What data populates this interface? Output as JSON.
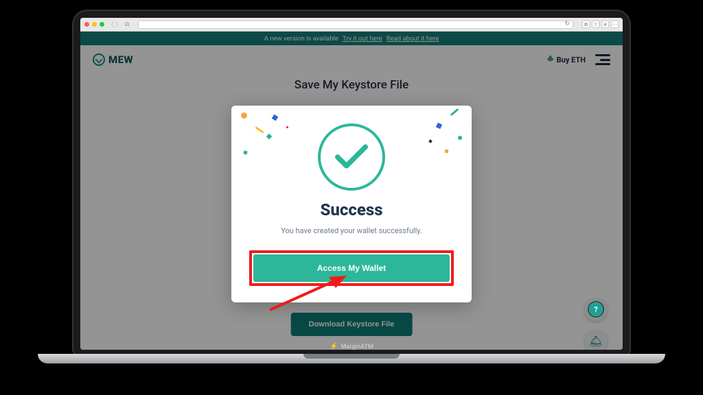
{
  "laptop_brand": "MarginATM",
  "announce": {
    "text": "A new version is available",
    "link1": "Try it out here",
    "link2": "Read about it here"
  },
  "header": {
    "logo_text": "MEW",
    "buy_eth_label": "Buy ETH"
  },
  "page_title": "Save My Keystore File",
  "download_button_label": "Download Keystore File",
  "modal": {
    "title": "Success",
    "message": "You have created your wallet successfully.",
    "access_button_label": "Access My Wallet"
  },
  "fab": {
    "help_symbol": "?",
    "support_symbol": "🛎"
  }
}
